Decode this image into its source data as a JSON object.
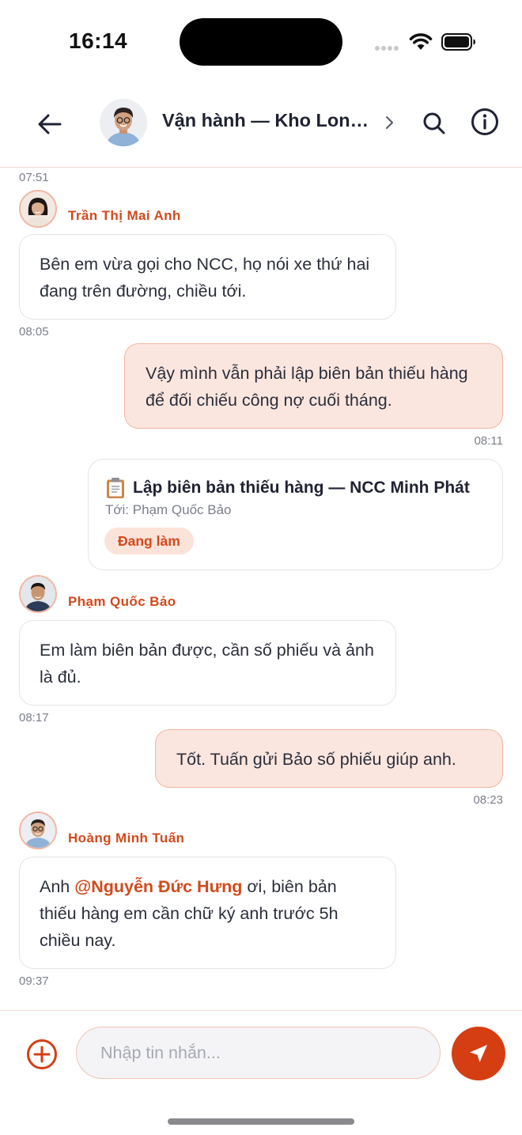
{
  "status_bar": {
    "time": "16:14"
  },
  "header": {
    "title": "Vận hành — Kho Long Biên",
    "back_icon": "arrow-left-icon",
    "search_icon": "search-icon",
    "info_icon": "info-icon"
  },
  "messages": [
    {
      "time": "07:51"
    },
    {
      "sender": "Trần Thị Mai Anh",
      "text": "Bên em vừa gọi cho NCC, họ nói xe thứ hai đang trên đường, chiều tới.",
      "time": "08:05"
    },
    {
      "text": "Vậy mình vẫn phải lập biên bản thiếu hàng để đối chiếu công nợ cuối tháng.",
      "time": "08:11"
    },
    {
      "task": {
        "icon": "clipboard-icon",
        "title": "Lập biên bản thiếu hàng — NCC Minh Phát",
        "assignee": "Tới: Phạm Quốc Bảo",
        "status": "Đang làm"
      }
    },
    {
      "sender": "Phạm Quốc Bảo",
      "text": "Em làm biên bản được, cần số phiếu và ảnh là đủ.",
      "time": "08:17"
    },
    {
      "text": "Tốt. Tuấn gửi Bảo số phiếu giúp anh.",
      "time": "08:23"
    },
    {
      "sender": "Hoàng Minh Tuấn",
      "text_before": "Anh ",
      "mention": "@Nguyễn Đức Hưng",
      "text_after": " ơi, biên bản thiếu hàng em cần chữ ký anh trước 5h chiều nay.",
      "time": "09:37"
    }
  ],
  "composer": {
    "placeholder": "Nhập tin nhắn...",
    "accent": "#d53e12"
  }
}
